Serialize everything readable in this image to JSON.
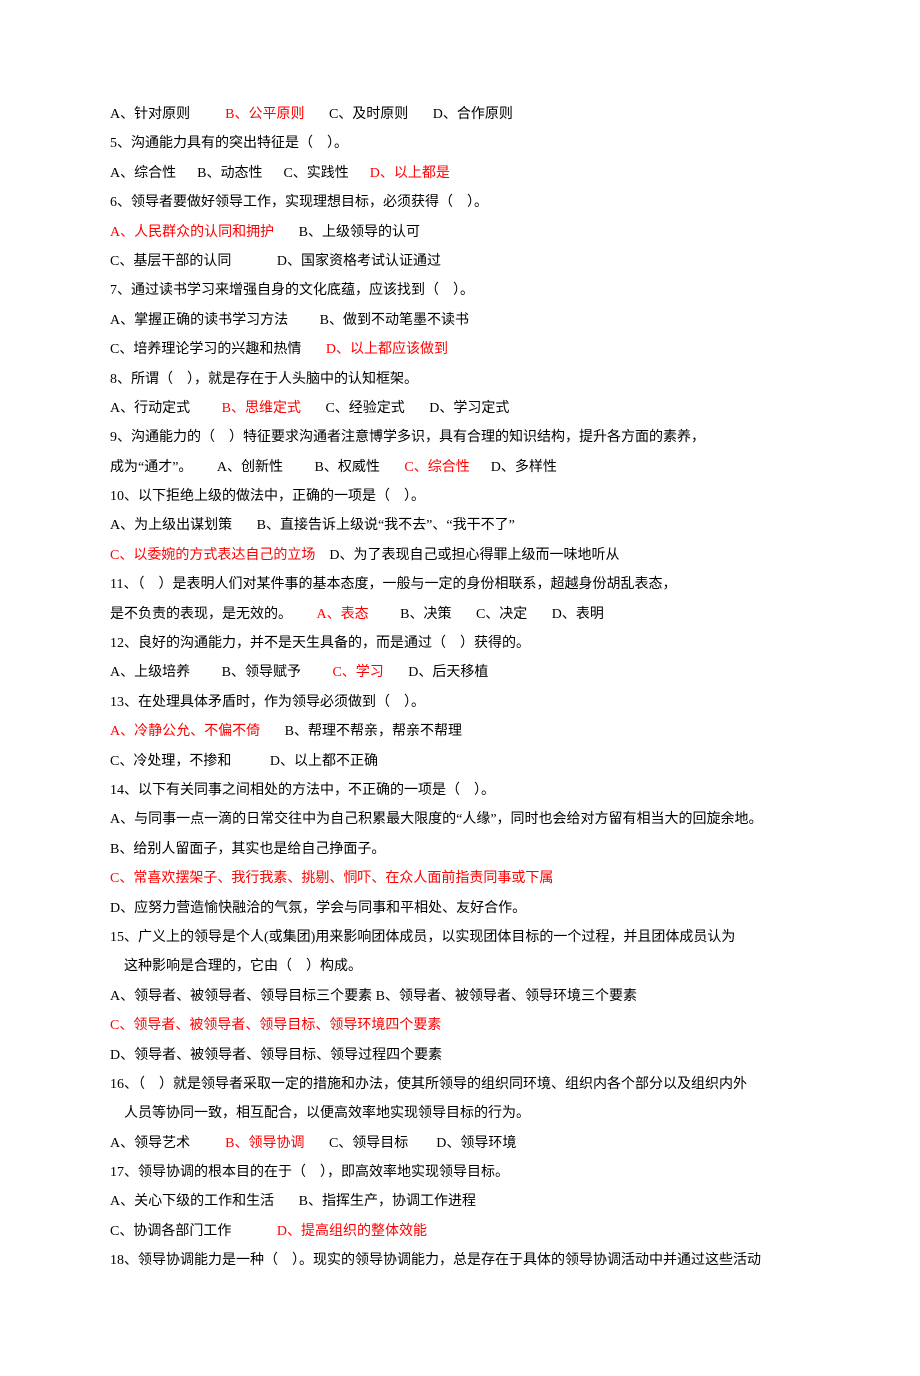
{
  "lines": [
    {
      "segments": [
        {
          "t": "A、针对原则          "
        },
        {
          "t": "B、公平原则",
          "red": true
        },
        {
          "t": "       C、及时原则       D、合作原则"
        }
      ]
    },
    {
      "segments": [
        {
          "t": "5、沟通能力具有的突出特征是（    ）。"
        }
      ]
    },
    {
      "segments": [
        {
          "t": "A、综合性      B、动态性      C、实践性      "
        },
        {
          "t": "D、以上都是",
          "red": true
        }
      ]
    },
    {
      "segments": [
        {
          "t": "6、领导者要做好领导工作，实现理想目标，必须获得（    ）。"
        }
      ]
    },
    {
      "segments": [
        {
          "t": "A、人民群众的认同和拥护",
          "red": true
        },
        {
          "t": "       B、上级领导的认可"
        }
      ]
    },
    {
      "segments": [
        {
          "t": "C、基层干部的认同             D、国家资格考试认证通过"
        }
      ]
    },
    {
      "segments": [
        {
          "t": "7、通过读书学习来增强自身的文化底蕴，应该找到（    ）。"
        }
      ]
    },
    {
      "segments": [
        {
          "t": "A、掌握正确的读书学习方法         B、做到不动笔墨不读书"
        }
      ]
    },
    {
      "segments": [
        {
          "t": "C、培养理论学习的兴趣和热情       "
        },
        {
          "t": "D、以上都应该做到",
          "red": true
        }
      ]
    },
    {
      "segments": [
        {
          "t": "8、所谓（    ），就是存在于人头脑中的认知框架。"
        }
      ]
    },
    {
      "segments": [
        {
          "t": "A、行动定式         "
        },
        {
          "t": "B、思维定式",
          "red": true
        },
        {
          "t": "       C、经验定式       D、学习定式"
        }
      ]
    },
    {
      "segments": [
        {
          "t": "9、沟通能力的（    ）特征要求沟通者注意博学多识，具有合理的知识结构，提升各方面的素养，"
        }
      ]
    },
    {
      "segments": [
        {
          "t": "成为“通才”。       A、创新性         B、权威性       "
        },
        {
          "t": "C、综合性",
          "red": true
        },
        {
          "t": "      D、多样性"
        }
      ]
    },
    {
      "segments": [
        {
          "t": "10、以下拒绝上级的做法中，正确的一项是（    ）。"
        }
      ]
    },
    {
      "segments": [
        {
          "t": "A、为上级出谋划策       B、直接告诉上级说“我不去”、“我干不了”"
        }
      ]
    },
    {
      "segments": [
        {
          "t": "C、以委婉的方式表达自己的立场",
          "red": true
        },
        {
          "t": "    D、为了表现自己或担心得罪上级而一味地听从"
        }
      ]
    },
    {
      "segments": [
        {
          "t": "11、（    ）是表明人们对某件事的基本态度，一般与一定的身份相联系，超越身份胡乱表态，"
        }
      ]
    },
    {
      "segments": [
        {
          "t": "是不负责的表现，是无效的。       "
        },
        {
          "t": "A、表态",
          "red": true
        },
        {
          "t": "         B、决策       C、决定       D、表明"
        }
      ]
    },
    {
      "segments": [
        {
          "t": "12、良好的沟通能力，并不是天生具备的，而是通过（    ）获得的。"
        }
      ]
    },
    {
      "segments": [
        {
          "t": "A、上级培养         B、领导赋予         "
        },
        {
          "t": "C、学习",
          "red": true
        },
        {
          "t": "       D、后天移植"
        }
      ]
    },
    {
      "segments": [
        {
          "t": "13、在处理具体矛盾时，作为领导必须做到（    ）。"
        }
      ]
    },
    {
      "segments": [
        {
          "t": "A、冷静公允、不偏不倚",
          "red": true
        },
        {
          "t": "       B、帮理不帮亲，帮亲不帮理"
        }
      ]
    },
    {
      "segments": [
        {
          "t": "C、冷处理，不掺和           D、以上都不正确"
        }
      ]
    },
    {
      "segments": [
        {
          "t": "14、以下有关同事之间相处的方法中，不正确的一项是（    ）。"
        }
      ]
    },
    {
      "segments": [
        {
          "t": "A、与同事一点一滴的日常交往中为自己积累最大限度的“人缘”，同时也会给对方留有相当大的回旋余地。"
        }
      ]
    },
    {
      "segments": [
        {
          "t": "B、给别人留面子，其实也是给自己挣面子。"
        }
      ]
    },
    {
      "segments": [
        {
          "t": "C、常喜欢摆架子、我行我素、挑剔、恫吓、在众人面前指责同事或下属",
          "red": true
        }
      ]
    },
    {
      "segments": [
        {
          "t": "D、应努力营造愉快融洽的气氛，学会与同事和平相处、友好合作。"
        }
      ]
    },
    {
      "segments": [
        {
          "t": "15、广义上的领导是个人(或集团)用来影响团体成员，以实现团体目标的一个过程，并且团体成员认为"
        }
      ]
    },
    {
      "segments": [
        {
          "t": "    这种影响是合理的，它由（    ）构成。"
        }
      ]
    },
    {
      "segments": [
        {
          "t": "A、领导者、被领导者、领导目标三个要素 B、领导者、被领导者、领导环境三个要素"
        }
      ]
    },
    {
      "segments": [
        {
          "t": "C、领导者、被领导者、领导目标、领导环境四个要素",
          "red": true
        }
      ]
    },
    {
      "segments": [
        {
          "t": "D、领导者、被领导者、领导目标、领导过程四个要素"
        }
      ]
    },
    {
      "segments": [
        {
          "t": "16、（    ）就是领导者采取一定的措施和办法，使其所领导的组织同环境、组织内各个部分以及组织内外"
        }
      ]
    },
    {
      "segments": [
        {
          "t": "    人员等协同一致，相互配合，以便高效率地实现领导目标的行为。"
        }
      ]
    },
    {
      "segments": [
        {
          "t": "A、领导艺术          "
        },
        {
          "t": "B、领导协调",
          "red": true
        },
        {
          "t": "       C、领导目标        D、领导环境"
        }
      ]
    },
    {
      "segments": [
        {
          "t": "17、领导协调的根本目的在于（    ），即高效率地实现领导目标。"
        }
      ]
    },
    {
      "segments": [
        {
          "t": "A、关心下级的工作和生活       B、指挥生产，协调工作进程"
        }
      ]
    },
    {
      "segments": [
        {
          "t": "C、协调各部门工作             "
        },
        {
          "t": "D、提高组织的整体效能",
          "red": true
        }
      ]
    },
    {
      "segments": [
        {
          "t": "18、领导协调能力是一种（    ）。现实的领导协调能力，总是存在于具体的领导协调活动中并通过这些活动"
        }
      ]
    }
  ]
}
